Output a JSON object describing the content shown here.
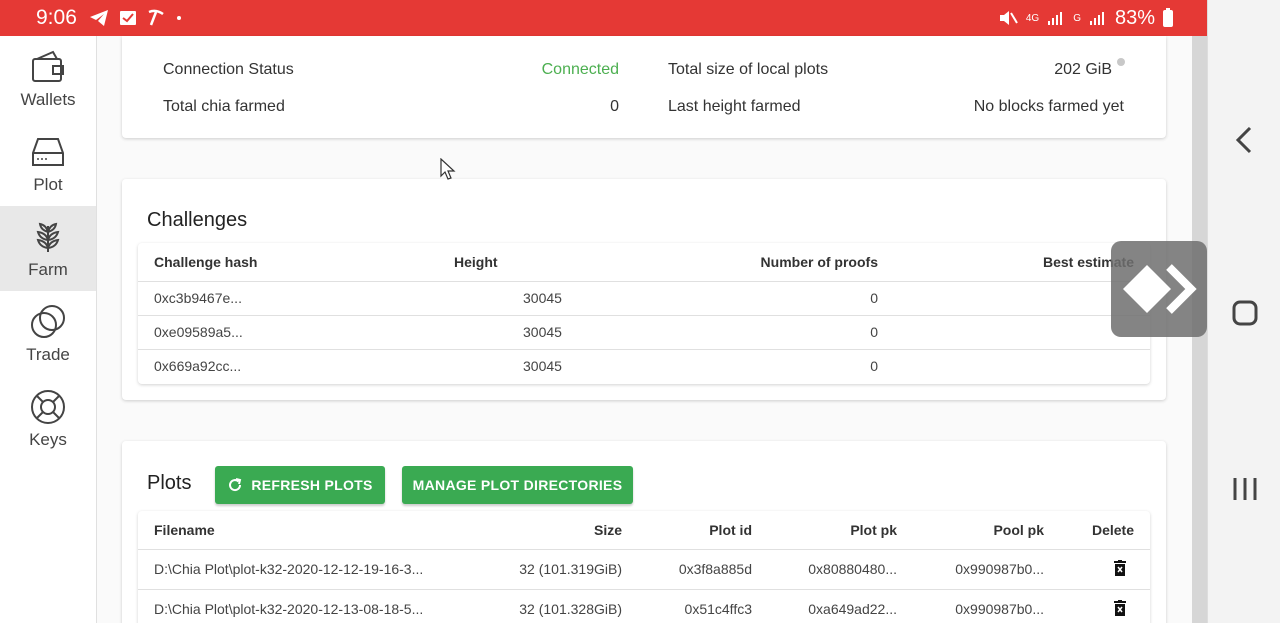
{
  "status_bar": {
    "time": "9:06",
    "battery": "83%",
    "net1": "4G",
    "net2": "G"
  },
  "sidebar": {
    "items": [
      {
        "label": "Wallets"
      },
      {
        "label": "Plot"
      },
      {
        "label": "Farm"
      },
      {
        "label": "Trade"
      },
      {
        "label": "Keys"
      }
    ]
  },
  "summary": {
    "connection_label": "Connection Status",
    "connection_value": "Connected",
    "chia_label": "Total chia farmed",
    "chia_value": "0",
    "size_label": "Total size of local plots",
    "size_value": "202 GiB",
    "height_label": "Last height farmed",
    "height_value": "No blocks farmed yet"
  },
  "challenges": {
    "title": "Challenges",
    "headers": [
      "Challenge hash",
      "Height",
      "Number of proofs",
      "Best estimate"
    ],
    "rows": [
      [
        "0xc3b9467e...",
        "30045",
        "0"
      ],
      [
        "0xe09589a5...",
        "30045",
        "0"
      ],
      [
        "0x669a92cc...",
        "30045",
        "0"
      ]
    ]
  },
  "plots": {
    "title": "Plots",
    "refresh_label": "REFRESH PLOTS",
    "manage_label": "MANAGE PLOT DIRECTORIES",
    "headers": [
      "Filename",
      "Size",
      "Plot id",
      "Plot pk",
      "Pool pk",
      "Delete"
    ],
    "rows": [
      [
        "D:\\Chia Plot\\plot-k32-2020-12-12-19-16-3...",
        "32 (101.319GiB)",
        "0x3f8a885d",
        "0x80880480...",
        "0x990987b0..."
      ],
      [
        "D:\\Chia Plot\\plot-k32-2020-12-13-08-18-5...",
        "32 (101.328GiB)",
        "0x51c4ffc3",
        "0xa649ad22...",
        "0x990987b0..."
      ]
    ]
  }
}
